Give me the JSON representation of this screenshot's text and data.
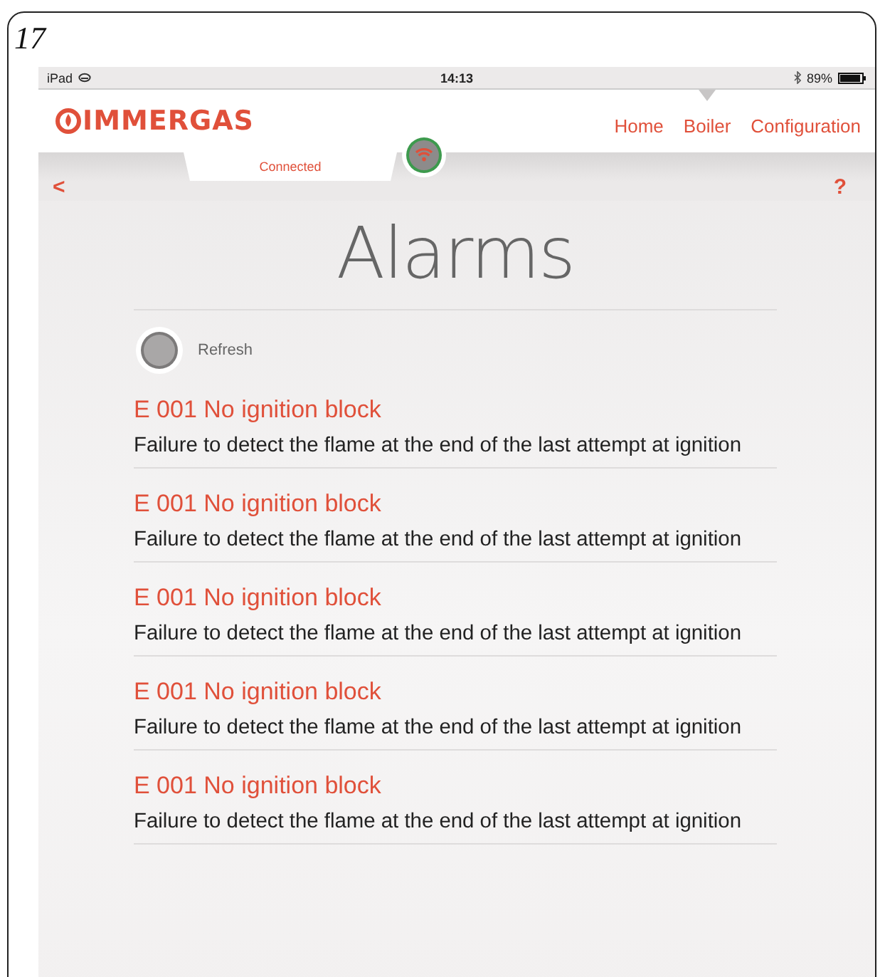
{
  "page_number": "17",
  "status_bar": {
    "device": "iPad",
    "time": "14:13",
    "battery": "89%"
  },
  "header": {
    "logo": "IMMERGAS",
    "nav": [
      {
        "label": "Home",
        "selected": false
      },
      {
        "label": "Boiler",
        "selected": true
      },
      {
        "label": "Configuration",
        "selected": false
      }
    ]
  },
  "connection": {
    "label": "Connected",
    "back": "<",
    "help": "?"
  },
  "title": "Alarms",
  "refresh": {
    "label": "Refresh"
  },
  "alarms": [
    {
      "code": "E 001 No ignition block",
      "description": "Failure to detect the flame at the end of the last attempt at ignition"
    },
    {
      "code": "E 001 No ignition block",
      "description": "Failure to detect the flame at the end of the last attempt at ignition"
    },
    {
      "code": "E 001 No ignition block",
      "description": "Failure to detect the flame at the end of the last attempt at ignition"
    },
    {
      "code": "E 001 No ignition block",
      "description": "Failure to detect the flame at the end of the last attempt at ignition"
    },
    {
      "code": "E 001 No ignition block",
      "description": "Failure to detect the flame at the end of the last attempt at ignition"
    }
  ]
}
